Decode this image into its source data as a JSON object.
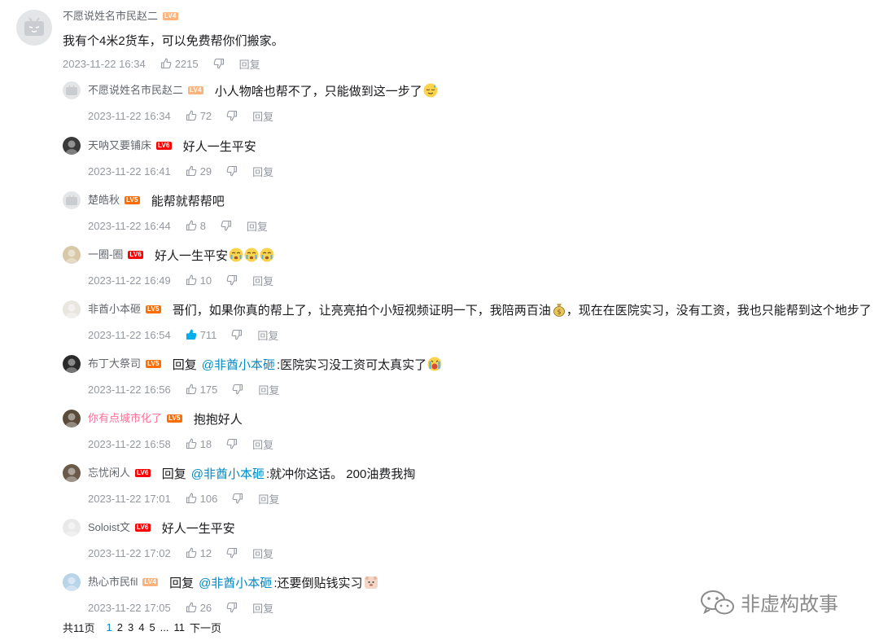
{
  "root": {
    "user": "不愿说姓名市民赵二",
    "level": "LV4",
    "text": "我有个4米2货车，可以免费帮你们搬家。",
    "time": "2023-11-22 16:34",
    "likes": "2215",
    "reply_label": "回复"
  },
  "replies": [
    {
      "user": "不愿说姓名市民赵二",
      "level": "LV4",
      "reply_word": "",
      "at": "",
      "text": "小人物啥也帮不了，只能做到这一步了",
      "time": "2023-11-22 16:34",
      "likes": "72",
      "reply_label": "回复",
      "emoji": "sweat-emoji"
    },
    {
      "user": "天呐又要铺床",
      "level": "LV6",
      "reply_word": "",
      "at": "",
      "text": "好人一生平安",
      "time": "2023-11-22 16:41",
      "likes": "29",
      "reply_label": "回复"
    },
    {
      "user": "楚皓秋",
      "level": "LV5",
      "reply_word": "",
      "at": "",
      "text": "能帮就帮帮吧",
      "time": "2023-11-22 16:44",
      "likes": "8",
      "reply_label": "回复"
    },
    {
      "user": "一圈-圈",
      "level": "LV6",
      "reply_word": "",
      "at": "",
      "text": "好人一生平安",
      "time": "2023-11-22 16:49",
      "likes": "10",
      "reply_label": "回复",
      "emoji": "crying-emoji-x3"
    },
    {
      "user": "非酋小本砸",
      "level": "LV5",
      "reply_word": "",
      "at": "",
      "text": "哥们，如果你真的帮上了，让亮亮拍个小短视频证明一下，我陪两百油",
      "text2": "，现在在医院实习，没有工资，我也只能帮到这个地步了",
      "time": "2023-11-22 16:54",
      "likes": "711",
      "reply_label": "回复",
      "emoji": "money-bag-emoji"
    },
    {
      "user": "布丁大祭司",
      "level": "LV5",
      "reply_word": "回复",
      "at": "@非酋小本砸",
      "text": ":医院实习没工资可太真实了",
      "time": "2023-11-22 16:56",
      "likes": "175",
      "reply_label": "回复",
      "emoji": "wailing-emoji"
    },
    {
      "user": "你有点城市化了",
      "level": "LV5",
      "reply_word": "",
      "at": "",
      "text": "抱抱好人",
      "time": "2023-11-22 16:58",
      "likes": "18",
      "reply_label": "回复"
    },
    {
      "user": "忘忧闲人",
      "level": "LV6",
      "reply_word": "回复",
      "at": "@非酋小本砸",
      "text": ":就冲你这话。 200油费我掏",
      "time": "2023-11-22 17:01",
      "likes": "106",
      "reply_label": "回复"
    },
    {
      "user": "Soloist文",
      "level": "LV6",
      "reply_word": "",
      "at": "",
      "text": "好人一生平安",
      "time": "2023-11-22 17:02",
      "likes": "12",
      "reply_label": "回复"
    },
    {
      "user": "热心市民fil",
      "level": "LV4",
      "reply_word": "回复",
      "at": "@非酋小本砸",
      "text": ":还要倒贴钱实习",
      "time": "2023-11-22 17:05",
      "likes": "26",
      "reply_label": "回复",
      "emoji": "bear-emoji"
    }
  ],
  "pager": {
    "total": "共11页",
    "pages": [
      "1",
      "2",
      "3",
      "4",
      "5",
      "...",
      "11"
    ],
    "current": "1",
    "next": "下一页"
  },
  "watermark": "非虚构故事",
  "colors": {
    "link": "#008ac5",
    "meta": "#9499a0",
    "pink_name": "#fb7299",
    "liked": "#00aeec"
  }
}
